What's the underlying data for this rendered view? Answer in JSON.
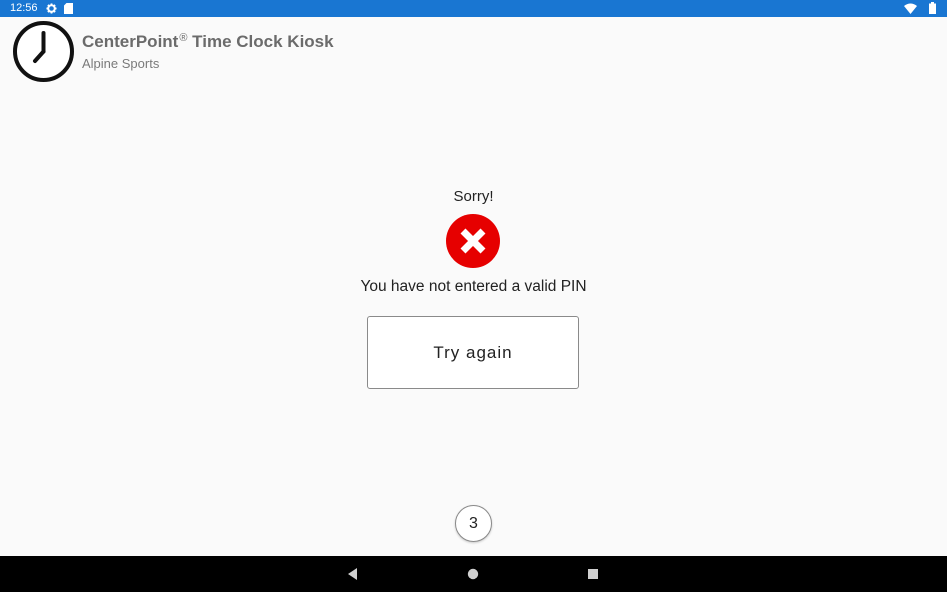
{
  "status_bar": {
    "time": "12:56",
    "icons": [
      "gear-icon",
      "sd-card-icon",
      "wifi-icon",
      "battery-icon"
    ],
    "color": "#1976d2"
  },
  "header": {
    "logo_icon": "clock-icon",
    "title": "CenterPoint",
    "title_mark": "®",
    "title_suffix": " Time Clock Kiosk",
    "subtitle": "Alpine Sports"
  },
  "result": {
    "heading": "Sorry!",
    "icon": "error-x-icon",
    "icon_color": "#e60000",
    "message": "You have not entered a valid PIN",
    "retry_label": "Try again"
  },
  "countdown": {
    "value": "3"
  },
  "nav_bar": {
    "buttons": [
      "back-icon",
      "home-icon",
      "recents-icon"
    ]
  }
}
